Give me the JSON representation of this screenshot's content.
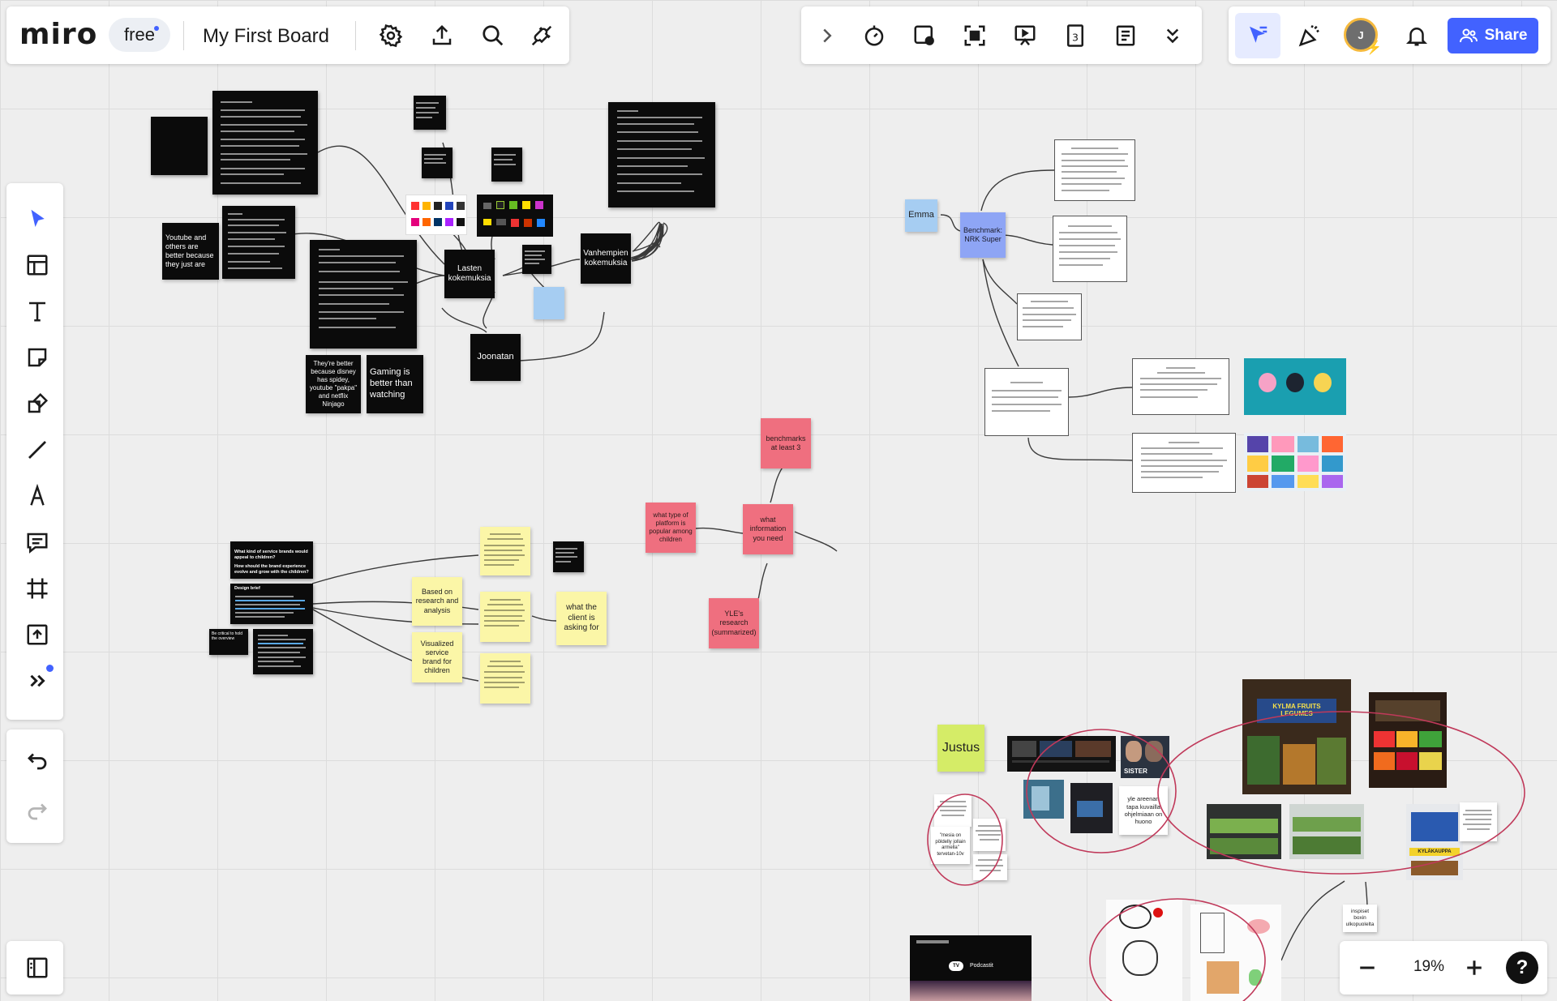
{
  "header": {
    "logo": "miro",
    "plan_badge": "free",
    "board_title": "My First Board"
  },
  "right_panel": {
    "share_label": "Share",
    "avatar_initial": "J"
  },
  "zoom": {
    "level": "19%"
  },
  "colors": {
    "accent": "#4262ff",
    "sticky_black": "#0b0b0b",
    "sticky_pink": "#ef6f7f",
    "sticky_yellow": "#fbf6a7",
    "sticky_blue": "#a6cdf2",
    "sticky_lime": "#d5ec67",
    "sticky_violet": "#8ea5f5",
    "circle": "#c0395a"
  },
  "icons": {
    "board_settings": "gear-icon",
    "export": "upload-icon",
    "search": "search-icon",
    "integrations": "plug-icon",
    "expand": "chevron-right-icon",
    "timer": "timer-icon",
    "frames": "frames-icon",
    "focus": "focus-icon",
    "presentation": "presentation-icon",
    "calendar": "calendar-icon",
    "notes": "notes-icon",
    "more": "double-chevron-down-icon",
    "select_cursor": "cursor-icon",
    "reactions": "party-icon",
    "notifications": "bell-icon",
    "share": "users-icon",
    "select": "select-arrow-icon",
    "templates": "templates-icon",
    "text": "text-icon",
    "sticky": "sticky-note-icon",
    "shapes": "shapes-icon",
    "line": "line-icon",
    "pen": "pen-icon",
    "comment": "comment-icon",
    "frame": "frame-icon",
    "upload": "upload-icon",
    "more_tools": "more-tools-icon",
    "undo": "undo-icon",
    "redo": "redo-icon",
    "board_panel": "panel-icon",
    "zoom_out": "minus-icon",
    "zoom_in": "plus-icon",
    "help": "help-icon"
  },
  "canvas": {
    "notes": {
      "youtube": "Youtube and others are better because they just are",
      "lasten": "Lasten kokemuksia",
      "vanhempien": "Vanhempien kokemuksia",
      "joonatan": "Joonatan",
      "disney": "They're better because disney has spidey, youtube \"pakpa\" and netflix Ninjago",
      "gaming": "Gaming is better than watching",
      "emma": "Emma",
      "benchmark": "Benchmark: NRK Super",
      "benchmarks3": "benchmarks at least 3",
      "what_type": "what type of platform is popular among children",
      "what_info": "what information you need",
      "yle": "YLE's research (summarized)",
      "based_on": "Based on research and analysis",
      "visualized": "Visualized service brand for children",
      "what_client": "what the client is asking for",
      "justus": "Justus",
      "yle_areenan": "yle areenan tapa kuvailla ohjelmiaan on huono",
      "inspiset": "inspiset boxin ulkopuolelta",
      "kaupoissa": "\"mesia on pöldelly jollain armella\" tervetan-10v"
    },
    "labels": {
      "design_brief": "Design brief",
      "what_kind": "What kind of service brands would appeal to children?",
      "how_should": "How should the brand experience evolve and grow with the children?",
      "be_critical": "Be critical to hold the overview"
    },
    "photos": {
      "store_sign": "KYLMA FRUITS LEGUMES",
      "store_sign2": "KYLÄKAUPPA",
      "tv_badge": "TV",
      "podcast_badge": "Podcastit",
      "series": "SISTER"
    }
  }
}
